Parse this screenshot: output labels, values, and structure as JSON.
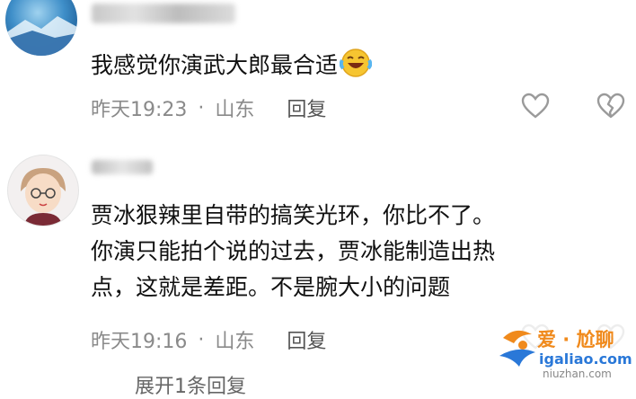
{
  "comments": [
    {
      "text_lines": [
        "我感觉你演武大郎最合适"
      ],
      "time": "昨天19:23",
      "dot": "·",
      "location": "山东",
      "reply_label": "回复"
    },
    {
      "text_lines": [
        "贾冰狠辣里自带的搞笑光环，你比不了。",
        "你演只能拍个说的过去，贾冰能制造出热",
        "点，这就是差距。不是腕大小的问题"
      ],
      "time": "昨天19:16",
      "dot": "·",
      "location": "山东",
      "reply_label": "回复"
    }
  ],
  "more_replies": "展开1条回复",
  "watermark": {
    "line1": "爱 · 尬聊",
    "line2": "igaliao.com",
    "line3": "niuzhan.com"
  },
  "colors": {
    "meta": "#8a8a8a",
    "text": "#111111",
    "watermark_orange": "#f08a1c",
    "watermark_blue": "#2a78d8"
  }
}
